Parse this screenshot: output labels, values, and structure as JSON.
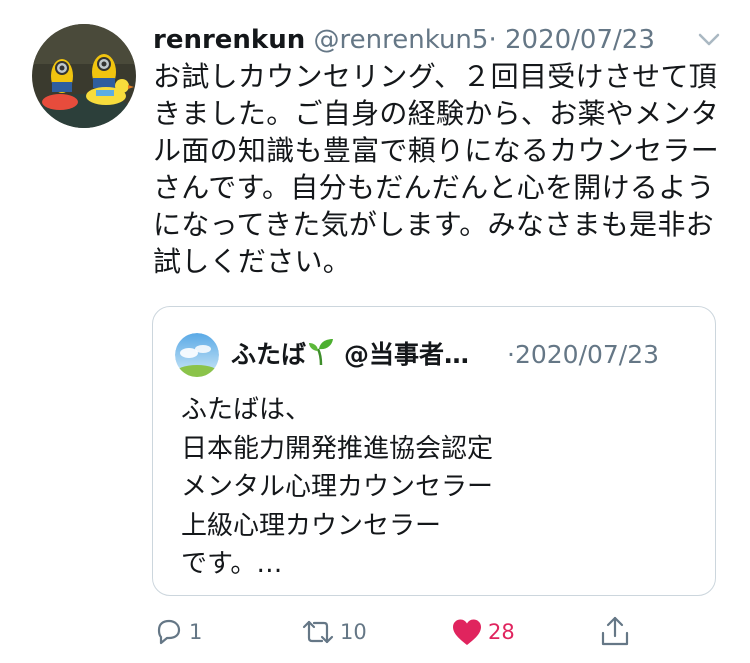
{
  "tweet": {
    "author_name": "renrenkun",
    "author_handle": "@renrenkun5",
    "separator": "·",
    "date": "2020/07/23",
    "lines": [
      "お試しカウンセリング、２回目受けさせて頂",
      "きました。ご自身の経験から、お薬やメンタ",
      "ル面の知識も豊富で頼りになるカウンセラー",
      "さんです。自分もだんだんと心を開けるよう",
      "になってきた気がします。みなさまも是非お",
      "試しください。"
    ]
  },
  "quoted": {
    "author_name": "ふたば",
    "author_handle": "@当事者…",
    "separator": "·",
    "date": "2020/07/23",
    "lines": [
      "ふたばは、",
      "日本能力開発推進協会認定",
      "メンタル心理カウンセラー",
      "上級心理カウンセラー",
      "です。…"
    ]
  },
  "actions": {
    "reply_count": "1",
    "retweet_count": "10",
    "like_count": "28"
  },
  "icons": {
    "caret": "chevron-down-icon",
    "reply": "reply-icon",
    "retweet": "retweet-icon",
    "like": "heart-icon",
    "share": "share-icon",
    "sprout": "sprout-icon"
  },
  "colors": {
    "text": "#14171a",
    "secondary": "#657786",
    "border": "#ccd6dd",
    "like": "#e0245e"
  }
}
